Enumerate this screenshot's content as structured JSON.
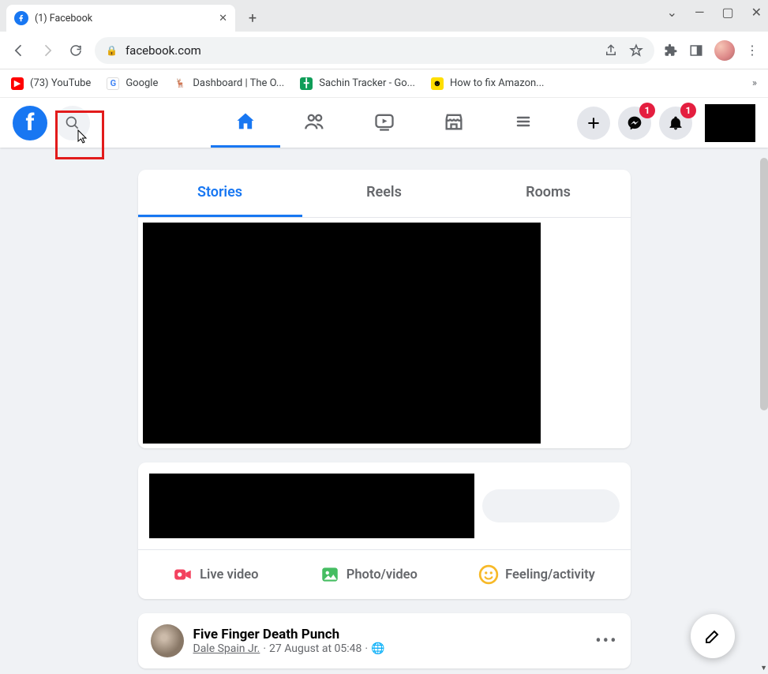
{
  "browser": {
    "tab_title": "(1) Facebook",
    "url": "facebook.com",
    "bookmarks": [
      {
        "label": "(73) YouTube",
        "color": "#ff0000",
        "icon": "▶"
      },
      {
        "label": "Google",
        "color": "#fff",
        "icon": "G"
      },
      {
        "label": "Dashboard | The O...",
        "color": "#f5d58a",
        "icon": "🦊"
      },
      {
        "label": "Sachin Tracker - Go...",
        "color": "#0f9d58",
        "icon": "▦"
      },
      {
        "label": "How to fix Amazon...",
        "color": "#ffde00",
        "icon": "☻"
      }
    ]
  },
  "fb": {
    "logo_letter": "f",
    "messenger_badge": "1",
    "notif_badge": "1",
    "tabs": {
      "stories": "Stories",
      "reels": "Reels",
      "rooms": "Rooms"
    },
    "composer": {
      "live": "Live video",
      "photo": "Photo/video",
      "feeling": "Feeling/activity"
    },
    "post": {
      "title": "Five Finger Death Punch",
      "author": "Dale Spain Jr.",
      "time": "27 August at 05:48"
    }
  }
}
